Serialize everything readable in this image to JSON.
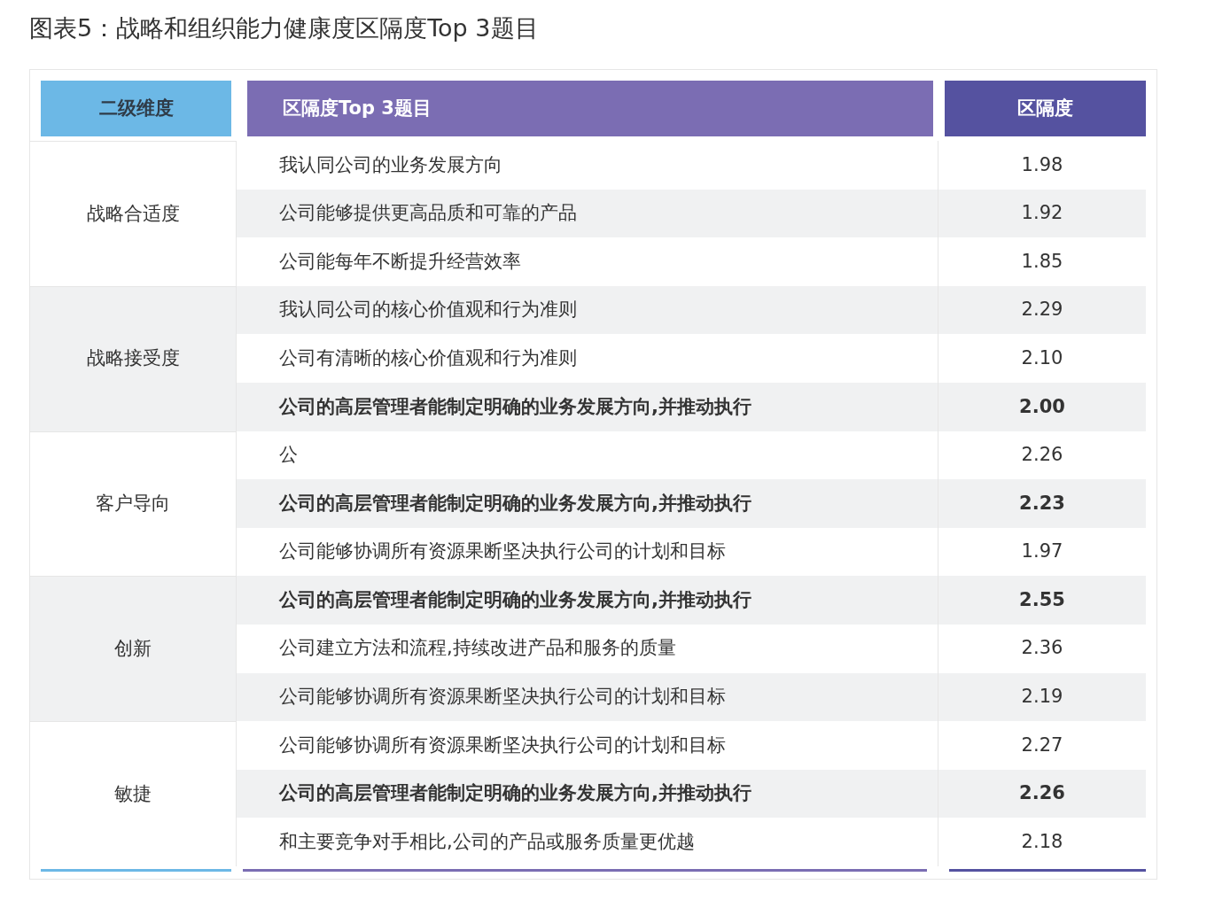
{
  "title": "图表5：战略和组织能力健康度区隔度Top 3题目",
  "columns": [
    "二级维度",
    "区隔度Top 3题目",
    "区隔度"
  ],
  "groups": [
    {
      "name": "战略合适度",
      "rows": [
        {
          "item": "我认同公司的业务发展方向",
          "value": "1.98",
          "bold": false
        },
        {
          "item": "公司能够提供更高品质和可靠的产品",
          "value": "1.92",
          "bold": false
        },
        {
          "item": "公司能每年不断提升经营效率",
          "value": "1.85",
          "bold": false
        }
      ]
    },
    {
      "name": "战略接受度",
      "rows": [
        {
          "item": "我认同公司的核心价值观和行为准则",
          "value": "2.29",
          "bold": false
        },
        {
          "item": "公司有清晰的核心价值观和行为准则",
          "value": "2.10",
          "bold": false
        },
        {
          "item": "公司的高层管理者能制定明确的业务发展方向,并推动执行",
          "value": "2.00",
          "bold": true
        }
      ]
    },
    {
      "name": "客户导向",
      "rows": [
        {
          "item": "公",
          "value": "2.26",
          "bold": false
        },
        {
          "item": "公司的高层管理者能制定明确的业务发展方向,并推动执行",
          "value": "2.23",
          "bold": true
        },
        {
          "item": "公司能够协调所有资源果断坚决执行公司的计划和目标",
          "value": "1.97",
          "bold": false
        }
      ]
    },
    {
      "name": "创新",
      "rows": [
        {
          "item": "公司的高层管理者能制定明确的业务发展方向,并推动执行",
          "value": "2.55",
          "bold": true
        },
        {
          "item": "公司建立方法和流程,持续改进产品和服务的质量",
          "value": "2.36",
          "bold": false
        },
        {
          "item": "公司能够协调所有资源果断坚决执行公司的计划和目标",
          "value": "2.19",
          "bold": false
        }
      ]
    },
    {
      "name": "敏捷",
      "rows": [
        {
          "item": "公司能够协调所有资源果断坚决执行公司的计划和目标",
          "value": "2.27",
          "bold": false
        },
        {
          "item": "公司的高层管理者能制定明确的业务发展方向,并推动执行",
          "value": "2.26",
          "bold": true
        },
        {
          "item": "和主要竞争对手相比,公司的产品或服务质量更优越",
          "value": "2.18",
          "bold": false
        }
      ]
    }
  ]
}
